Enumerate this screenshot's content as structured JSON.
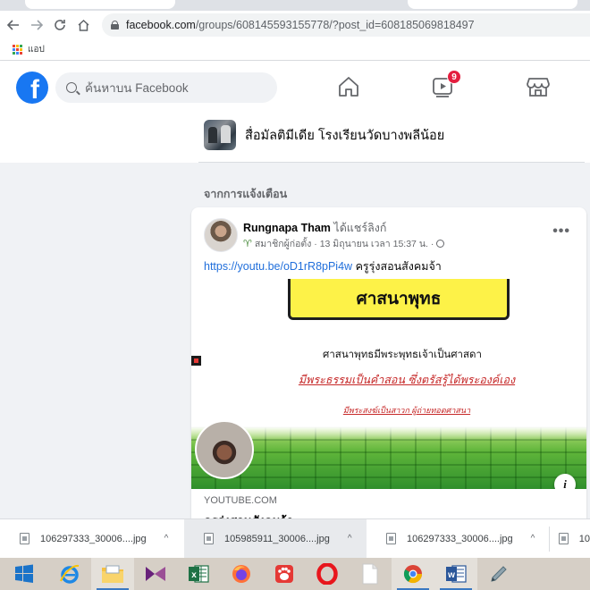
{
  "browser": {
    "url_domain": "facebook.com",
    "url_path": "/groups/608145593155778/?post_id=608185069818497",
    "bookmarks_label": "แอป"
  },
  "facebook": {
    "search_placeholder": "ค้นหาบน Facebook",
    "video_badge_count": "9",
    "brand_color": "#1877f2"
  },
  "group": {
    "name": "สื่อมัลติมีเดีย โรงเรียนวัดบางพลีน้อย"
  },
  "section_label": "จากการแจ้งเตือน",
  "post": {
    "author": "Rungnapa Tham",
    "action": "ได้แชร์ลิงก์",
    "meta_role": "สมาชิกผู้ก่อตั้ง",
    "meta_time": "· 13 มิถุนายน เวลา 15:37 น. ·",
    "more": "•••",
    "link_url": "https://youtu.be/oD1rR8pPi4w",
    "link_caption": "ครูรุ่งสอนสังคมจ้า",
    "slide": {
      "title": "ศาสนาพุทธ",
      "line1": "ศาสนาพุทธมีพระพุทธเจ้าเป็นศาสดา",
      "line2": "มีพระธรรมเป็นคำสอน ซึ่งตรัสรู้ได้พระองค์เอง",
      "line3": "มีพระสงฆ์เป็นสาวก ผู้ถ่ายทอดศาสนา"
    },
    "info_symbol": "i",
    "domain": "YOUTUBE.COM",
    "link_title": "ครูรุ่งสอนสังคมจ้า"
  },
  "downloads": [
    {
      "name": "106297333_30006....jpg",
      "caret": "^"
    },
    {
      "name": "105985911_30006....jpg",
      "caret": "^"
    },
    {
      "name": "106297333_30006....jpg",
      "caret": "^"
    },
    {
      "name": "10",
      "caret": ""
    }
  ],
  "taskbar": {
    "icons": [
      "windows-start-icon",
      "internet-explorer-icon",
      "file-explorer-icon",
      "visual-studio-icon",
      "excel-icon",
      "firefox-icon",
      "baidu-icon",
      "opera-icon",
      "blank-file-icon",
      "chrome-icon",
      "word-icon",
      "pen-tool-icon"
    ]
  }
}
